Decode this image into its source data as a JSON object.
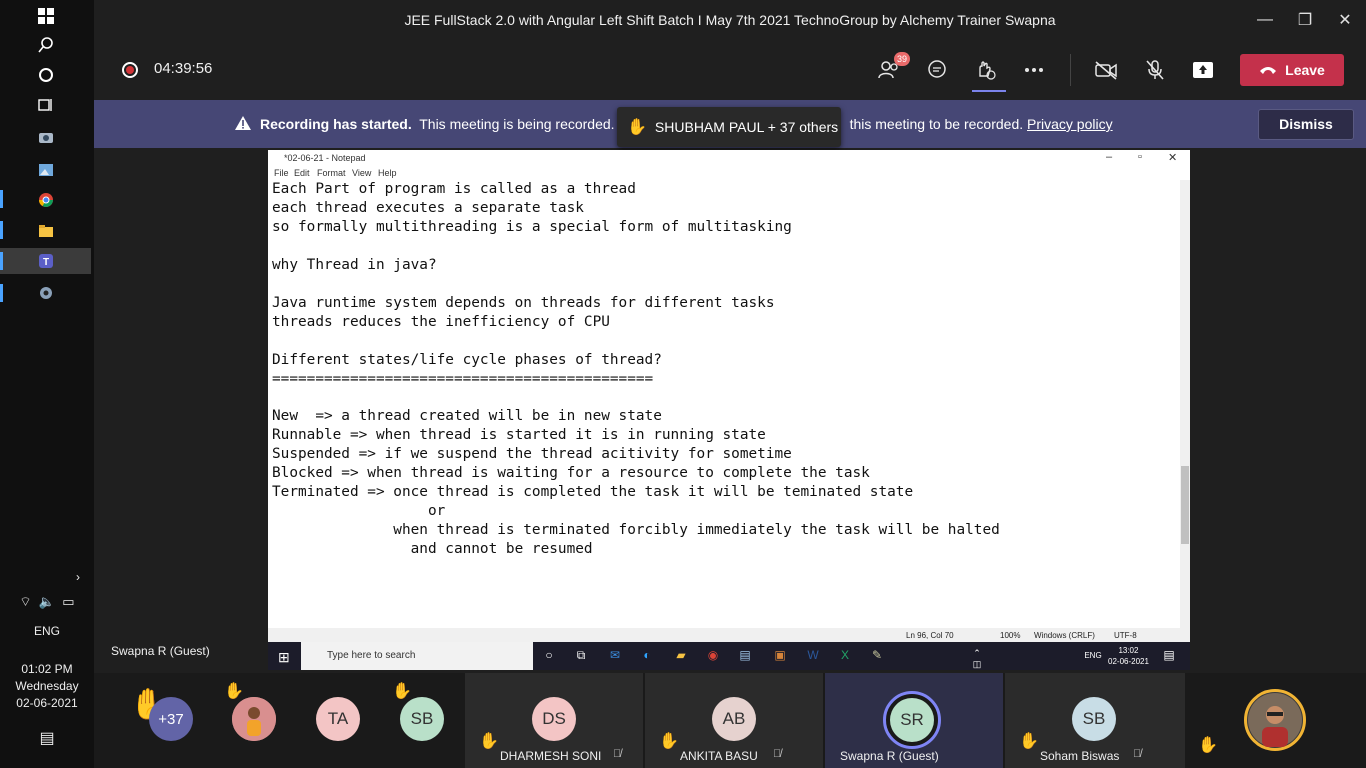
{
  "taskbar": {
    "icons": [
      "windows-icon",
      "search-icon",
      "cortana-icon",
      "task-view-icon",
      "camera-app-icon",
      "photos-icon",
      "chrome-icon",
      "file-explorer-icon",
      "teams-icon",
      "settings-icon"
    ],
    "language": "ENG",
    "time": "01:02 PM",
    "day": "Wednesday",
    "date": "02-06-2021",
    "expand_glyph": "›",
    "notification_glyph": "▤"
  },
  "window": {
    "title": "JEE FullStack 2.0 with Angular Left Shift Batch I May 7th 2021 TechnoGroup by Alchemy Trainer Swapna",
    "minimize": "—",
    "maximize": "❐",
    "close": "✕"
  },
  "meeting": {
    "timer": "04:39:56",
    "participants_badge": "39",
    "leave_label": "Leave"
  },
  "recording_banner": {
    "strong": "Recording has started.",
    "text_before": "This meeting is being recorded. E",
    "text_after": "this meeting to be recorded.",
    "privacy_link": "Privacy policy",
    "dismiss_label": "Dismiss"
  },
  "raise_hand_toast": {
    "text": "SHUBHAM PAUL + 37 others"
  },
  "notepad": {
    "title": "*02-06-21 - Notepad",
    "menu": [
      "File",
      "Edit",
      "Format",
      "View",
      "Help"
    ],
    "lines": [
      "Each Part of program is called as a thread",
      "each thread executes a separate task",
      "so formally multithreading is a special form of multitasking",
      "",
      "why Thread in java?",
      "",
      "Java runtime system depends on threads for different tasks",
      "threads reduces the inefficiency of CPU",
      "",
      "Different states/life cycle phases of thread?",
      "============================================",
      "",
      "New  => a thread created will be in new state",
      "Runnable => when thread is started it is in running state",
      "Suspended => if we suspend the thread acitivity for sometime",
      "Blocked => when thread is waiting for a resource to complete the task",
      "Terminated => once thread is completed the task it will be teminated state",
      "                  or",
      "              when thread is terminated forcibly immediately the task will be halted",
      "                and cannot be resumed"
    ],
    "status": {
      "position": "Ln 96, Col 70",
      "zoom": "100%",
      "line_ending": "Windows (CRLF)",
      "encoding": "UTF-8"
    },
    "inner_taskbar": {
      "search_placeholder": "Type here to search",
      "language": "ENG",
      "time": "13:02",
      "date": "02-06-2021"
    }
  },
  "presenter_name": "Swapna R (Guest)",
  "participants": [
    {
      "initials": "+37",
      "name": "",
      "color": "#6264a7"
    },
    {
      "initials": "",
      "name": "",
      "color": "#e8a0a0"
    },
    {
      "initials": "TA",
      "name": "",
      "color": "#f3c5c5"
    },
    {
      "initials": "SB",
      "name": "",
      "color": "#b9e0c9"
    },
    {
      "initials": "DS",
      "name": "DHARMESH SONI",
      "color": "#f3c5c5"
    },
    {
      "initials": "AB",
      "name": "ANKITA BASU",
      "color": "#e6d2cf"
    },
    {
      "initials": "SR",
      "name": "Swapna R (Guest)",
      "color": "#b9e0c9"
    },
    {
      "initials": "SB",
      "name": "Soham Biswas",
      "color": "#c8dde6"
    }
  ]
}
